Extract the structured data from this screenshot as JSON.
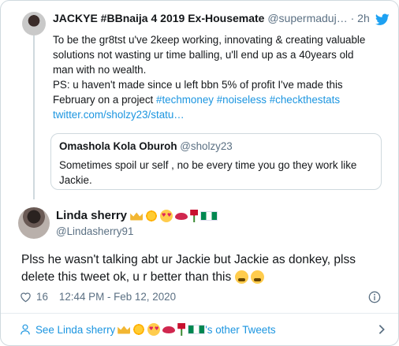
{
  "parent_tweet": {
    "name": "JACKYE #BBnaija 4 2019 Ex-Housemate",
    "handle": "@supermaduj…",
    "separator": "·",
    "time": "2h",
    "text_lines": [
      "To be the gr8tst u've 2keep working, innovating & creating valuable",
      "solutions not wasting ur time balling, u'll end up as a 40years old",
      "man with no wealth."
    ],
    "ps_text": "PS: u haven't made since u left bbn 5% of profit I've made this",
    "ps_text2": "February on a project",
    "hashtags": [
      "#techmoney",
      "#noiseless",
      "#checkthestats"
    ],
    "link": "twitter.com/sholzy23/statu…"
  },
  "quoted_tweet": {
    "name": "Omashola Kola Oburoh",
    "handle": "@sholzy23",
    "text": "Sometimes spoil ur self , no be every time you go they work like Jackie."
  },
  "main_tweet": {
    "name": "Linda sherry",
    "handle": "@Lindasherry91",
    "text": "Plss he wasn't talking abt ur Jackie but Jackie as donkey, plss delete this tweet ok, u r better than this",
    "likes": "16",
    "timestamp": "12:44 PM - Feb 12, 2020"
  },
  "footer": {
    "prefix": "See Linda sherry",
    "suffix": "'s other Tweets"
  },
  "colors": {
    "link": "#1b95e0",
    "secondary_text": "#5b7083",
    "border": "#cfd9de"
  },
  "icons": [
    "twitter-bird-icon",
    "heart-icon",
    "info-icon",
    "person-icon",
    "chevron-right-icon"
  ]
}
